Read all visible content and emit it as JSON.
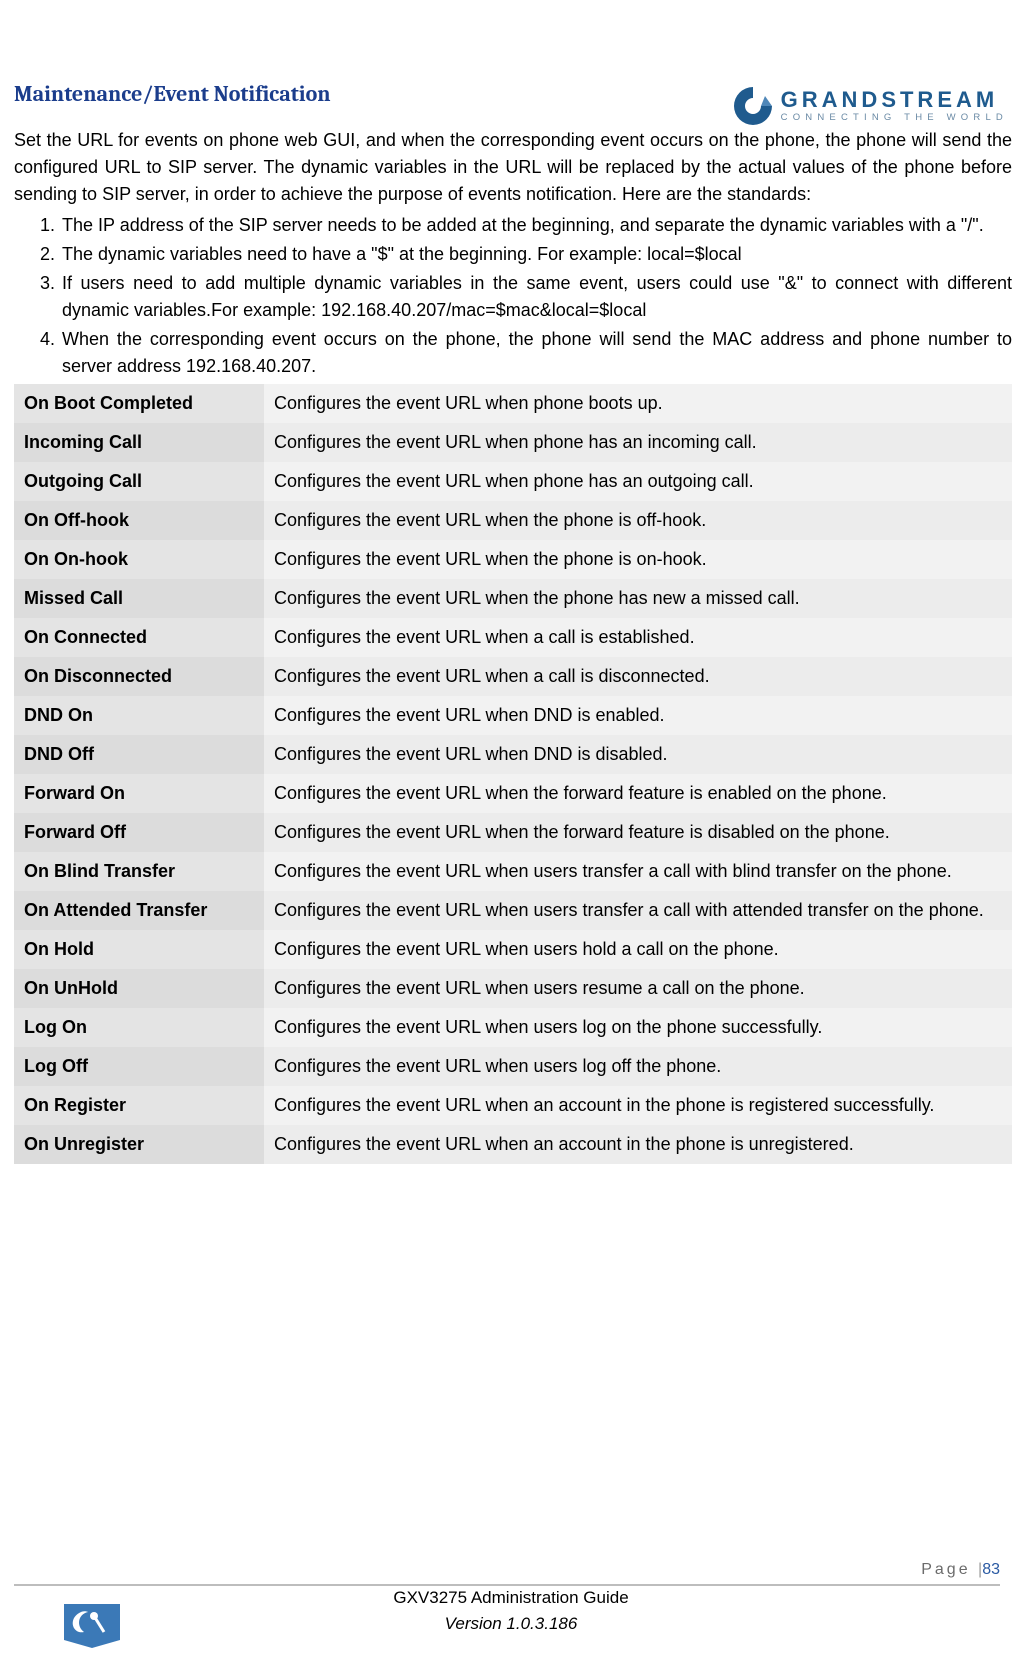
{
  "logo": {
    "brand": "GRANDSTREAM",
    "tagline": "CONNECTING THE WORLD"
  },
  "section_title": "Maintenance/Event Notification",
  "intro": "Set the URL for events on phone web GUI, and when the corresponding event occurs on the phone, the phone will send the configured URL to SIP server. The dynamic variables in the URL will be replaced by the actual values of the phone before sending to SIP server, in order to achieve the purpose of events notification. Here are the standards:",
  "standards": [
    "The IP address of the SIP server needs to be added at the beginning, and separate the dynamic variables with a \"/\".",
    "The dynamic variables need to have a \"$\" at the beginning. For example: local=$local",
    "If users need to add multiple dynamic variables in the same event, users could use \"&\" to connect with different dynamic variables.For example: 192.168.40.207/mac=$mac&local=$local",
    "When the corresponding event occurs on the phone, the phone will send the MAC address and phone number to server address 192.168.40.207."
  ],
  "events": [
    {
      "name": "On Boot Completed",
      "desc": "Configures the event URL when phone boots up."
    },
    {
      "name": "Incoming Call",
      "desc": "Configures the event URL when phone has an incoming call."
    },
    {
      "name": "Outgoing Call",
      "desc": "Configures the event URL when phone has an outgoing call."
    },
    {
      "name": "On Off-hook",
      "desc": "Configures the event URL when the phone is off-hook."
    },
    {
      "name": "On On-hook",
      "desc": "Configures the event URL when the phone is on-hook."
    },
    {
      "name": "Missed Call",
      "desc": "Configures the event URL when the phone has new a missed call."
    },
    {
      "name": "On Connected",
      "desc": "Configures the event URL when a call is established."
    },
    {
      "name": "On Disconnected",
      "desc": "Configures the event URL when a call is disconnected."
    },
    {
      "name": "DND On",
      "desc": "Configures the event URL when DND is enabled."
    },
    {
      "name": "DND Off",
      "desc": "Configures the event URL when DND is disabled."
    },
    {
      "name": "Forward On",
      "desc": "Configures the event URL when the forward feature is enabled on the phone."
    },
    {
      "name": "Forward Off",
      "desc": "Configures the event URL when the forward feature is disabled on the phone."
    },
    {
      "name": "On Blind Transfer",
      "desc": "Configures the event URL when users transfer a call with blind transfer on the phone."
    },
    {
      "name": "On Attended Transfer",
      "desc": "Configures the event URL when users transfer a call with attended transfer on the phone."
    },
    {
      "name": "On Hold",
      "desc": "Configures the event URL when users hold a call on the phone."
    },
    {
      "name": "On UnHold",
      "desc": "Configures the event URL when users resume a call on the phone."
    },
    {
      "name": "Log On",
      "desc": "Configures the event URL when users log on the phone successfully."
    },
    {
      "name": "Log Off",
      "desc": "Configures the event URL when users log off the phone."
    },
    {
      "name": "On Register",
      "desc": "Configures the event URL when an account in the phone is registered successfully."
    },
    {
      "name": "On Unregister",
      "desc": "Configures the event URL when an account in the phone is unregistered."
    }
  ],
  "footer": {
    "guide": "GXV3275 Administration Guide",
    "version": "Version 1.0.3.186",
    "page_label": "Page ",
    "page_num": "83",
    "sep": "|"
  }
}
